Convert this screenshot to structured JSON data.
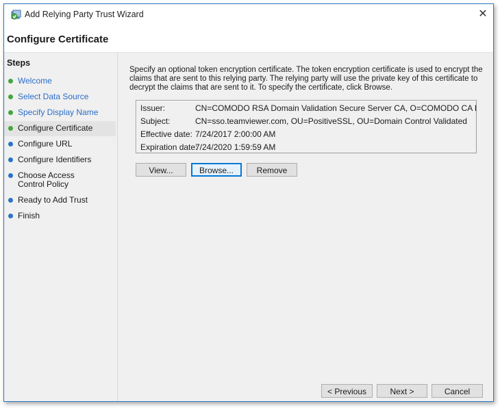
{
  "window": {
    "title": "Add Relying Party Trust Wizard",
    "close_glyph": "✕"
  },
  "header": {
    "page_title": "Configure Certificate"
  },
  "sidebar": {
    "title": "Steps",
    "items": [
      {
        "label": "Welcome",
        "state": "done"
      },
      {
        "label": "Select Data Source",
        "state": "done"
      },
      {
        "label": "Specify Display Name",
        "state": "done"
      },
      {
        "label": "Configure Certificate",
        "state": "current"
      },
      {
        "label": "Configure URL",
        "state": "todo"
      },
      {
        "label": "Configure Identifiers",
        "state": "todo"
      },
      {
        "label": "Choose Access Control Policy",
        "state": "todo"
      },
      {
        "label": "Ready to Add Trust",
        "state": "todo"
      },
      {
        "label": "Finish",
        "state": "todo"
      }
    ]
  },
  "main": {
    "description": "Specify an optional token encryption certificate.  The token encryption certificate is used to encrypt the claims that are sent to this relying party.  The relying party will use the private key of this certificate to decrypt the claims that are sent to it.  To specify the certificate, click Browse.",
    "certificate": {
      "issuer_label": "Issuer:",
      "issuer_value": "CN=COMODO RSA Domain Validation Secure Server CA, O=COMODO CA Limited, L=S",
      "subject_label": "Subject:",
      "subject_value": "CN=sso.teamviewer.com, OU=PositiveSSL, OU=Domain Control Validated",
      "effective_label": "Effective date:",
      "effective_value": "7/24/2017 2:00:00 AM",
      "expiration_label": "Expiration date:",
      "expiration_value": "7/24/2020 1:59:59 AM"
    },
    "buttons": {
      "view": "View...",
      "browse": "Browse...",
      "remove": "Remove"
    }
  },
  "footer": {
    "previous": "< Previous",
    "next": "Next >",
    "cancel": "Cancel"
  },
  "colors": {
    "done_step": "#2b6ec7",
    "green_dot": "#41a63f",
    "blue_dot": "#2a74c6",
    "window_border": "#2b79c2"
  }
}
